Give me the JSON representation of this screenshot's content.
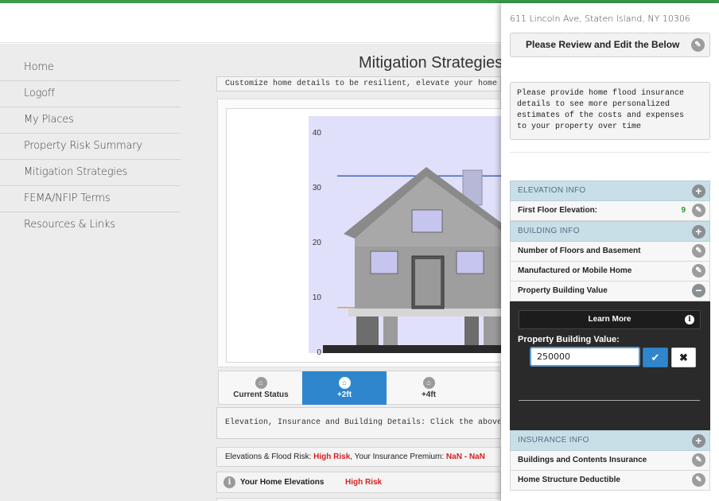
{
  "nav": {
    "items": [
      "Home",
      "Logoff",
      "My Places",
      "Property Risk Summary",
      "Mitigation Strategies",
      "FEMA/NFIP Terms",
      "Resources & Links"
    ]
  },
  "main": {
    "title": "Mitigation Strategies",
    "customize_text": "Customize home details to be resilient, elevate your home and bui",
    "details_text": "Elevation, Insurance and Building Details: Click the above right",
    "risk_label": "Elevations & Flood Risk:",
    "risk_value": "High Risk",
    "premium_label": ", Your Insurance Premium:",
    "premium_value": "NaN - NaN",
    "home_elevations_label": "Your Home Elevations",
    "home_elevations_risk": "High Risk"
  },
  "tabs": [
    {
      "label": "Current Status",
      "icon": "home-icon",
      "active": false
    },
    {
      "label": "+2ft",
      "icon": "home-icon",
      "active": true
    },
    {
      "label": "+4ft",
      "icon": "home-icon",
      "active": false
    }
  ],
  "chart_data": {
    "type": "line",
    "title": "",
    "xlabel": "",
    "ylabel": "",
    "ylim": [
      0,
      40
    ],
    "y_ticks": [
      "0",
      "10",
      "20",
      "30",
      "40"
    ],
    "series": [
      {
        "values": [
          32,
          32
        ],
        "color": "#3d63c9"
      },
      {
        "values": [
          8,
          8
        ],
        "color": "#f09a3c"
      }
    ],
    "plot_bg": "#e0e0fa"
  },
  "drawer": {
    "address": "611 Lincoln Ave, Staten Island, NY 10306",
    "review_button": "Please Review and Edit the Below",
    "notice": "Please provide home flood insurance\ndetails to see more personalized\nestimates of the costs and expenses\nto your property over time",
    "sections": {
      "elevation": {
        "title": "ELEVATION INFO",
        "first_floor_label": "First Floor Elevation:",
        "first_floor_value": "9"
      },
      "building": {
        "title": "BUILDING INFO",
        "floors_label": "Number of Floors and Basement",
        "manufactured_label": "Manufactured or Mobile Home",
        "value_label": "Property Building Value"
      },
      "insurance": {
        "title": "INSURANCE INFO",
        "contents_label": "Buildings and Contents Insurance",
        "deductible_label": "Home Structure Deductible"
      }
    },
    "editor": {
      "learn_more": "Learn More",
      "field_label": "Property Building Value:",
      "field_value": "250000"
    }
  },
  "colors": {
    "accent_blue": "#2f86cc",
    "risk_red": "#d61f1f",
    "success_green": "#2a9a2a",
    "section_head": "#c9dfe8",
    "top_bar": "#3a9a4a"
  }
}
